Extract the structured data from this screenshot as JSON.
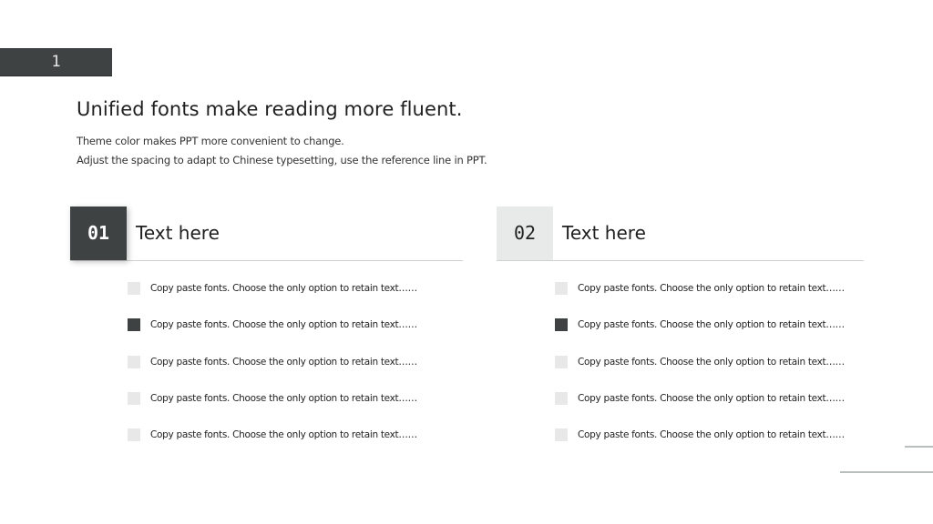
{
  "page_number": "1",
  "title": "Unified fonts make reading more fluent.",
  "subtitle_lines": [
    "Theme color makes PPT more convenient to change.",
    "Adjust the spacing to adapt to Chinese typesetting, use the reference line in PPT."
  ],
  "colors": {
    "accent_dark": "#3e4242",
    "accent_light": "#e8eaea",
    "divider": "#cfd2d2"
  },
  "sections": [
    {
      "number": "01",
      "title": "Text here",
      "items": [
        {
          "text": "Copy paste fonts. Choose the only option to retain text……",
          "highlight": false
        },
        {
          "text": "Copy paste fonts. Choose the only option to retain text……",
          "highlight": true
        },
        {
          "text": "Copy paste fonts. Choose the only option to retain text……",
          "highlight": false
        },
        {
          "text": "Copy paste fonts. Choose the only option to retain text……",
          "highlight": false
        },
        {
          "text": "Copy paste fonts. Choose the only option to retain text……",
          "highlight": false
        }
      ]
    },
    {
      "number": "02",
      "title": "Text here",
      "items": [
        {
          "text": "Copy paste fonts. Choose the only option to retain text……",
          "highlight": false
        },
        {
          "text": "Copy paste fonts. Choose the only option to retain text……",
          "highlight": true
        },
        {
          "text": "Copy paste fonts. Choose the only option to retain text……",
          "highlight": false
        },
        {
          "text": "Copy paste fonts. Choose the only option to retain text……",
          "highlight": false
        },
        {
          "text": "Copy paste fonts. Choose the only option to retain text……",
          "highlight": false
        }
      ]
    }
  ]
}
